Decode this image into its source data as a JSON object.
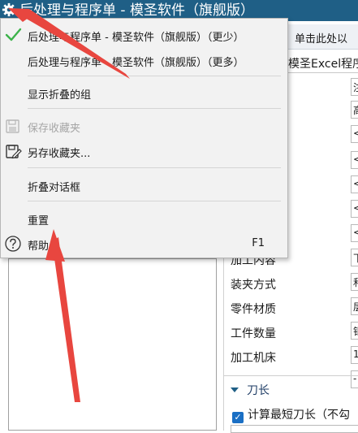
{
  "window": {
    "title": "后处理与程序单 - 模圣软件（旗舰版）"
  },
  "background": {
    "hint_button": "单击此处以",
    "breadcrumb": "模圣Excel程序",
    "field_values": [
      "注",
      "高",
      "<",
      "<",
      "<",
      "<",
      "<",
      "下",
      "和",
      "层",
      "钼",
      "1",
      "-"
    ],
    "rows": [
      {
        "label": "加工内容"
      },
      {
        "label": "装夹方式"
      },
      {
        "label": "零件材质"
      },
      {
        "label": "工件数量"
      },
      {
        "label": "加工机床"
      }
    ],
    "section": {
      "title": "刀长"
    },
    "checkbox": {
      "label": "计算最短刀长（不勾",
      "checked": true
    }
  },
  "menu": {
    "items": [
      {
        "label": "后处理与程序单 - 模圣软件（旗舰版）（更少）",
        "icon": "checkmark-icon",
        "checked": true,
        "enabled": true
      },
      {
        "label": "后处理与程序单 - 模圣软件（旗舰版）（更多）",
        "enabled": true
      },
      {
        "label": "显示折叠的组",
        "enabled": true
      },
      {
        "label": "保存收藏夹",
        "icon": "save-favorites-icon",
        "enabled": false
      },
      {
        "label": "另存收藏夹...",
        "icon": "save-as-favorites-icon",
        "enabled": true
      },
      {
        "label": "折叠对话框",
        "enabled": true
      },
      {
        "label": "重置",
        "enabled": true
      },
      {
        "label": "帮助",
        "icon": "help-icon",
        "shortcut": "F1",
        "enabled": true
      }
    ]
  },
  "colors": {
    "title_bar": "#1f5f86",
    "menu_bg": "#f2f2f2",
    "check_green": "#3cb34a",
    "arrow_red": "#e8463f"
  }
}
